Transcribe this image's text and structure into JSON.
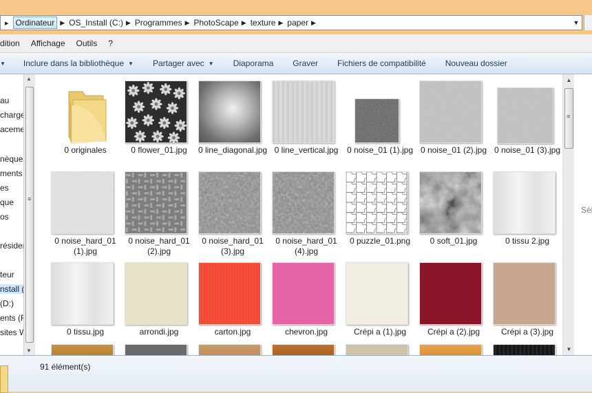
{
  "address_bar": {
    "crumbs": [
      "Ordinateur",
      "OS_Install (C:)",
      "Programmes",
      "PhotoScape",
      "texture",
      "paper"
    ]
  },
  "menu": {
    "items": [
      "dition",
      "Affichage",
      "Outils",
      "?"
    ]
  },
  "commands": {
    "include": "Inclure dans la bibliothèque",
    "share": "Partager avec",
    "slideshow": "Diaporama",
    "burn": "Graver",
    "compat": "Fichiers de compatibilité",
    "newfolder": "Nouveau dossier"
  },
  "nav_items": [
    "au",
    "charger",
    "acemen",
    "",
    "nèques",
    "ments",
    "es",
    "que",
    "os",
    "",
    "résider",
    "",
    "teur",
    "nstall (C",
    "(D:)",
    "ents (F",
    "sites W"
  ],
  "details_pane_text": "Sél",
  "files": [
    {
      "name": "0 originales",
      "kind": "folder"
    },
    {
      "name": "0 flower_01.jpg",
      "kind": "flower"
    },
    {
      "name": "0 line_diagonal.jpg",
      "kind": "blur"
    },
    {
      "name": "0 line_vertical.jpg",
      "kind": "vertical"
    },
    {
      "name": "0 noise_01 (1).jpg",
      "kind": "darknoise"
    },
    {
      "name": "0 noise_01 (2).jpg",
      "kind": "graynoise"
    },
    {
      "name": "0 noise_01 (3).jpg",
      "kind": "graynoise"
    },
    {
      "name": "0 noise_hard_01 (1).jpg",
      "kind": "lightnoise"
    },
    {
      "name": "0 noise_hard_01 (2).jpg",
      "kind": "weave"
    },
    {
      "name": "0 noise_hard_01 (3).jpg",
      "kind": "rough"
    },
    {
      "name": "0 noise_hard_01 (4).jpg",
      "kind": "rough"
    },
    {
      "name": "0 puzzle_01.png",
      "kind": "puzzle"
    },
    {
      "name": "0 soft_01.jpg",
      "kind": "clouds"
    },
    {
      "name": "0 tissu 2.jpg",
      "kind": "tissu"
    },
    {
      "name": "0 tissu.jpg",
      "kind": "tissu"
    },
    {
      "name": "arrondi.jpg",
      "kind": "beige"
    },
    {
      "name": "carton.jpg",
      "kind": "orange"
    },
    {
      "name": "chevron.jpg",
      "kind": "pink"
    },
    {
      "name": "Crépi a (1).jpg",
      "kind": "cream"
    },
    {
      "name": "Crépi a (2).jpg",
      "kind": "crimson"
    },
    {
      "name": "Crépi a (3).jpg",
      "kind": "tan"
    }
  ],
  "status": {
    "count": "91 élément(s)"
  }
}
